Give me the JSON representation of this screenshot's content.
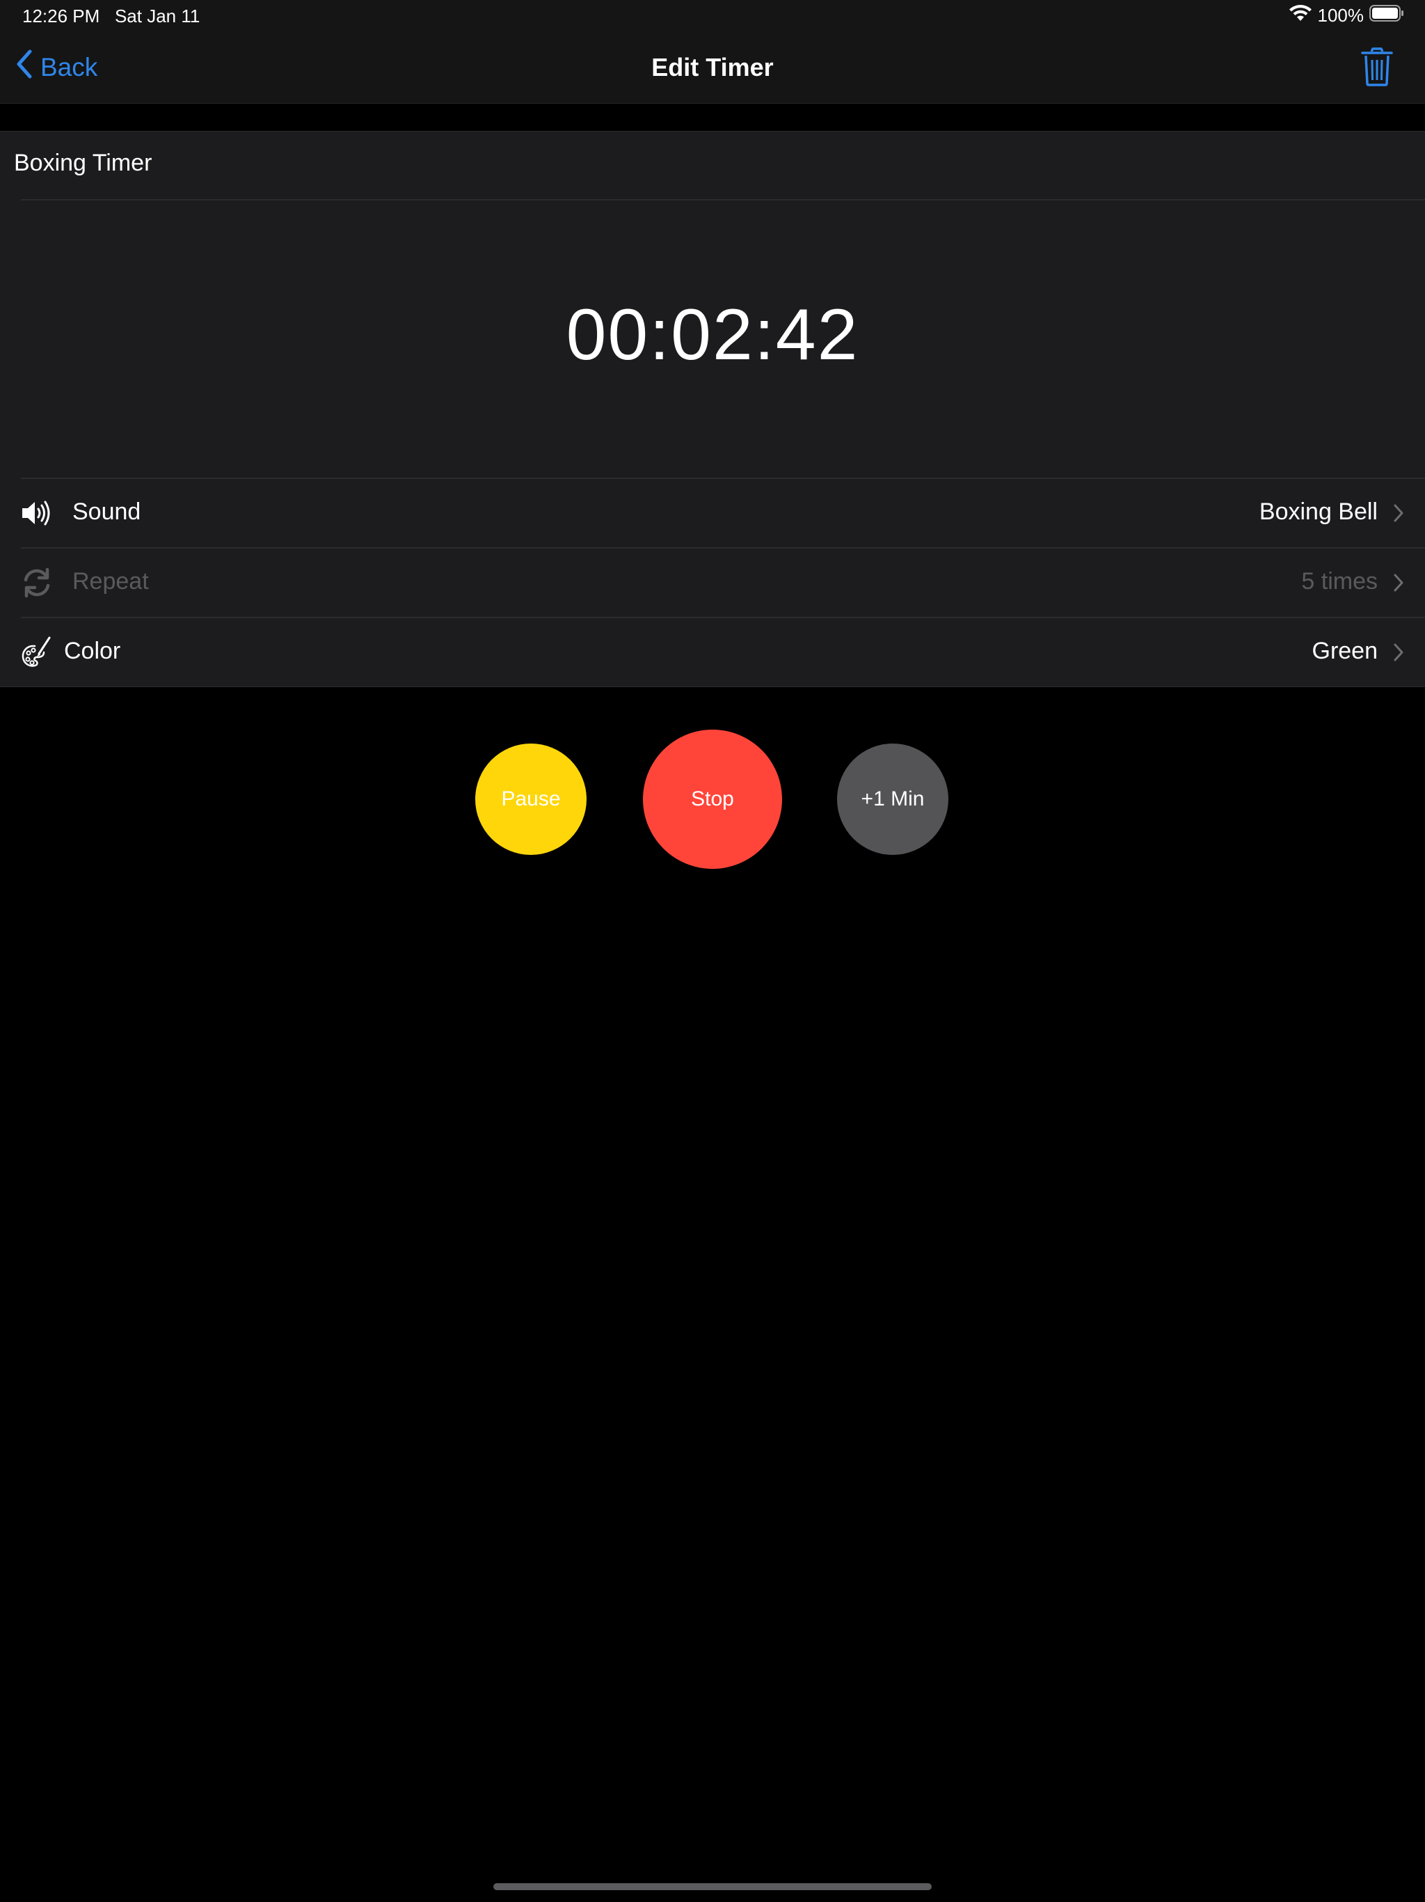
{
  "status_bar": {
    "time": "12:26 PM",
    "date": "Sat Jan 11",
    "battery": "100%"
  },
  "nav": {
    "back_label": "Back",
    "title": "Edit Timer"
  },
  "timer": {
    "name": "Boxing Timer",
    "remaining": "00:02:42"
  },
  "settings": {
    "sound": {
      "label": "Sound",
      "value": "Boxing Bell"
    },
    "repeat": {
      "label": "Repeat",
      "value": "5 times"
    },
    "color": {
      "label": "Color",
      "value": "Green"
    }
  },
  "controls": {
    "pause_label": "Pause",
    "stop_label": "Stop",
    "add_minute_label": "+1 Min"
  },
  "colors": {
    "accent": "#2f86ea",
    "pause": "#ffd60a",
    "stop": "#ff453a",
    "add_minute": "#545456"
  }
}
